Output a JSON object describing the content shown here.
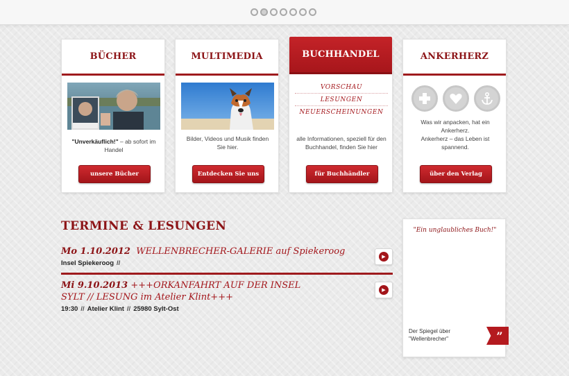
{
  "slider": {
    "dot_count": 7,
    "active_index": 1
  },
  "cards": [
    {
      "title": "BÜCHER",
      "image_icon": "author-photo",
      "text_bold": "\"Unverkäuflich!\"",
      "text": " – ab sofort im Handel",
      "button": "unsere Bücher"
    },
    {
      "title": "MULTIMEDIA",
      "image_icon": "dog-photo",
      "text": "Bilder, Videos und Musik finden Sie hier.",
      "button": "Entdecken Sie uns"
    },
    {
      "title": "BUCHHANDEL",
      "links": [
        "VORSCHAU",
        "LESUNGEN",
        "NEUERSCHEINUNGEN"
      ],
      "text": "alle Informationen, speziell für den Buchhandel, finden Sie hier",
      "button": "für Buchhändler"
    },
    {
      "title": "ANKERHERZ",
      "icons": [
        "cross-icon",
        "heart-icon",
        "anchor-icon"
      ],
      "text_line1": "Was wir anpacken, hat ein Ankerherz.",
      "text_line2": "Ankerherz – das Leben ist spannend.",
      "button": "über den Verlag"
    }
  ],
  "events": {
    "section_title": "TERMINE & LESUNGEN",
    "items": [
      {
        "date": "Mo 1.10.2012",
        "title": "WELLENBRECHER-GALERIE auf Spiekeroog",
        "meta": [
          "Insel Spiekeroog",
          ""
        ]
      },
      {
        "date": "Mi 9.10.2013",
        "title": "+++ORKANFAHRT AUF DER INSEL SYLT // LESUNG im Atelier Klint+++",
        "meta": [
          "19:30",
          "Atelier Klint",
          "25980 Sylt-Ost"
        ]
      }
    ],
    "separator": "//"
  },
  "quote": {
    "text": "\"Ein unglaubliches Buch!\"",
    "source": "Der Spiegel über \"Wellenbrecher\"",
    "mark": "”"
  },
  "colors": {
    "accent": "#a3151a",
    "accent_dark": "#8c1316",
    "background": "#ebebeb"
  }
}
